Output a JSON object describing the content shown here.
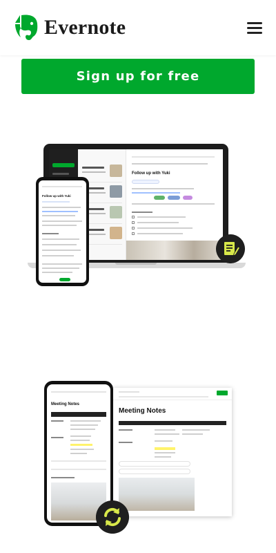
{
  "header": {
    "brand": "Evernote",
    "logo_icon": "elephant-logo-icon",
    "menu_icon": "hamburger-menu-icon"
  },
  "cta": {
    "signup_label": "Sign up for free"
  },
  "hero_laptop": {
    "note_title": "Follow up with Yuki"
  },
  "hero_phone_small": {
    "note_title": "Follow up with Yuki"
  },
  "hero_doc": {
    "note_title": "Meeting Notes"
  },
  "hero_phone_large": {
    "note_title": "Meeting Notes"
  },
  "colors": {
    "brand_green": "#00a82d",
    "dark": "#1f1f1f",
    "highlight_yellow": "#fff36b"
  },
  "icons": {
    "badge_top": "edit-note-icon",
    "badge_bottom": "sync-icon"
  }
}
